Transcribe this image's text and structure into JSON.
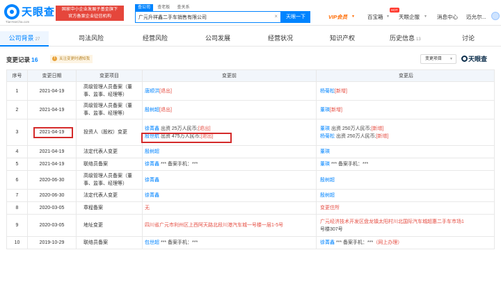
{
  "header": {
    "logo_text": "天眼查",
    "logo_sub": "TianYanCha.com",
    "promo_line1": "国家中小企业发展子基金旗下",
    "promo_line2": "官方备案企业征信机构",
    "search_tabs": [
      "查公司",
      "查老板",
      "查关系"
    ],
    "search_value": "广元升祥鑫二手车销售有限公司",
    "search_clear": "×",
    "search_button": "天眼一下",
    "nav_vip": "VIP会员",
    "nav_baobao": "百宝箱",
    "hot_badge": "HOT",
    "nav_enterprise": "天眼企服",
    "nav_messages": "消息中心",
    "nav_user": "迈允尔..."
  },
  "tabs": [
    {
      "label": "公司背景",
      "count": "27"
    },
    {
      "label": "司法风险",
      "count": ""
    },
    {
      "label": "经营风险",
      "count": ""
    },
    {
      "label": "公司发展",
      "count": ""
    },
    {
      "label": "经营状况",
      "count": ""
    },
    {
      "label": "知识产权",
      "count": ""
    },
    {
      "label": "历史信息",
      "count": "13"
    },
    {
      "label": "讨论",
      "count": ""
    }
  ],
  "section": {
    "title": "变更记录",
    "count": "16",
    "notice": "关注变更时通知我",
    "filter_label": "变更项目",
    "filter_arrow": "▼",
    "watermark": "天眼查"
  },
  "table": {
    "headers": [
      "序号",
      "变更日期",
      "变更项目",
      "变更前",
      "变更后"
    ],
    "rows": [
      {
        "no": "1",
        "date": "2021-04-19",
        "item": [
          "高级管理人员备案（董",
          "事、监事、经理等）"
        ],
        "before": [
          {
            "name": "唐顺洪",
            "rest": "",
            "tag": "[退出]"
          }
        ],
        "after": [
          {
            "name": "杨菊松",
            "rest": "",
            "tag": "[新增]"
          }
        ]
      },
      {
        "no": "2",
        "date": "2021-04-19",
        "item": [
          "高级管理人员备案（董",
          "事、监事、经理等）"
        ],
        "before": [
          {
            "name": "殷树超",
            "rest": "",
            "tag": "[退出]"
          }
        ],
        "after": [
          {
            "name": "董瑛",
            "rest": "",
            "tag": "[新增]"
          }
        ]
      },
      {
        "no": "3",
        "date": "2021-04-19",
        "item": [
          "投资人（股权）变更"
        ],
        "before": [
          {
            "name": "徐菁鑫",
            "rest": " 出资 25万人民币;",
            "tag": "[退出]"
          },
          {
            "name": "殷世航",
            "rest": " 出资 475万人民币;",
            "tag": "[退出]"
          }
        ],
        "after": [
          {
            "name": "董瑛",
            "rest": " 出资 250万人民币;",
            "tag": "[新增]"
          },
          {
            "name": "杨菊松",
            "rest": " 出资 250万人民币;",
            "tag": "[新增]"
          }
        ]
      },
      {
        "no": "4",
        "date": "2021-04-19",
        "item": [
          "法定代表人变更"
        ],
        "before": [
          {
            "name": "殷树超",
            "rest": "",
            "tag": ""
          }
        ],
        "after": [
          {
            "name": "董瑛",
            "rest": "",
            "tag": ""
          }
        ]
      },
      {
        "no": "5",
        "date": "2021-04-19",
        "item": [
          "联络员备案"
        ],
        "before": [
          {
            "name": "徐菁鑫",
            "rest": " *** 备案手机：***",
            "tag": ""
          }
        ],
        "after": [
          {
            "name": "董瑛",
            "rest": " *** 备案手机：***",
            "tag": ""
          }
        ]
      },
      {
        "no": "6",
        "date": "2020-06-30",
        "item": [
          "高级管理人员备案（董",
          "事、监事、经理等）"
        ],
        "before": [
          {
            "name": "徐菁鑫",
            "rest": "",
            "tag": ""
          }
        ],
        "after": [
          {
            "name": "殷树超",
            "rest": "",
            "tag": ""
          }
        ]
      },
      {
        "no": "7",
        "date": "2020-06-30",
        "item": [
          "法定代表人变更"
        ],
        "before": [
          {
            "name": "徐菁鑫",
            "rest": "",
            "tag": ""
          }
        ],
        "after": [
          {
            "name": "殷树超",
            "rest": "",
            "tag": ""
          }
        ]
      },
      {
        "no": "8",
        "date": "2020-03-05",
        "item": [
          "章程备案"
        ],
        "before": [
          {
            "name": "",
            "rest": "",
            "tag": "无"
          }
        ],
        "after": [
          {
            "name": "",
            "rest": "",
            "tag": "变更住所"
          }
        ]
      },
      {
        "no": "9",
        "date": "2020-03-05",
        "item": [
          "地址变更"
        ],
        "before": [
          {
            "name": "",
            "rest": "",
            "tag": "四川省广元市利州区上西阿天路北段川港汽车城一号楼一层1-5号"
          }
        ],
        "after": [
          {
            "name": "",
            "rest": "",
            "tag": "广元经济技术开发区盘龙镇太阳村川北国际汽车城超惠二手车市场1"
          },
          {
            "name": "",
            "rest": "",
            "tag": "号楼307号"
          }
        ]
      },
      {
        "no": "10",
        "date": "2019-10-29",
        "item": [
          "联络员备案"
        ],
        "before": [
          {
            "name": "包世超",
            "rest": " *** 备案手机：***",
            "tag": ""
          }
        ],
        "after": [
          {
            "name": "徐菁鑫",
            "rest": " *** 备案手机：***",
            "tag": "（网上办理）"
          }
        ]
      }
    ]
  },
  "colors": {
    "accent": "#0084ff",
    "removed": "#e54d42",
    "highlight_box": "#d42a2a",
    "promo": "#e5463b",
    "vip": "#ff6a00"
  }
}
